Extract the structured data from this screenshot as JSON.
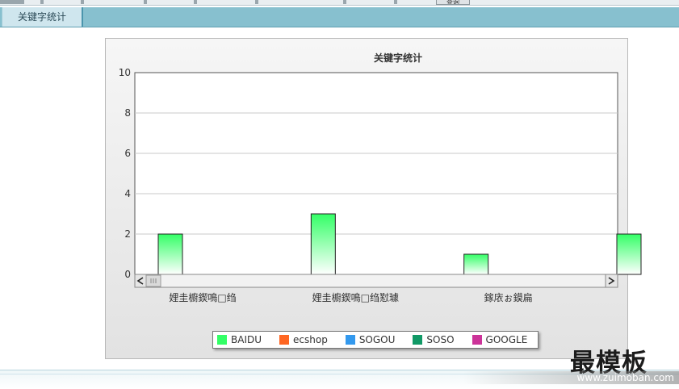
{
  "tab": {
    "label": "关键字统计"
  },
  "toolbar": {
    "query_label": "查询"
  },
  "colors": {
    "bar_top": "#33ff66",
    "bar_bottom": "#ffffff",
    "tabbar": "#87c0cf"
  },
  "chart_data": {
    "type": "bar",
    "title": "关键字统计",
    "categories": [
      "娌圭櫥鍥鳴□绉",
      "娌圭櫥鍥鳴□绉懟璩",
      "鎵庡ぉ鏌扁",
      ""
    ],
    "series": [
      {
        "name": "BAIDU",
        "color": "#33ff66",
        "values": [
          2,
          3,
          1,
          2
        ]
      },
      {
        "name": "ecshop",
        "color": "#ff6622",
        "values": [
          0,
          0,
          0,
          0
        ]
      },
      {
        "name": "SOGOU",
        "color": "#3399ee",
        "values": [
          0,
          0,
          0,
          0
        ]
      },
      {
        "name": "SOSO",
        "color": "#119966",
        "values": [
          0,
          0,
          0,
          0
        ]
      },
      {
        "name": "GOOGLE",
        "color": "#cc3399",
        "values": [
          0,
          0,
          0,
          0
        ]
      }
    ],
    "yticks": [
      0,
      2,
      4,
      6,
      8,
      10
    ],
    "ylim": [
      0,
      10
    ],
    "grid": true,
    "legend": "bottom",
    "scrollbar": true
  },
  "watermark": {
    "text": "最模板",
    "url": "www.zuimoban.com"
  }
}
